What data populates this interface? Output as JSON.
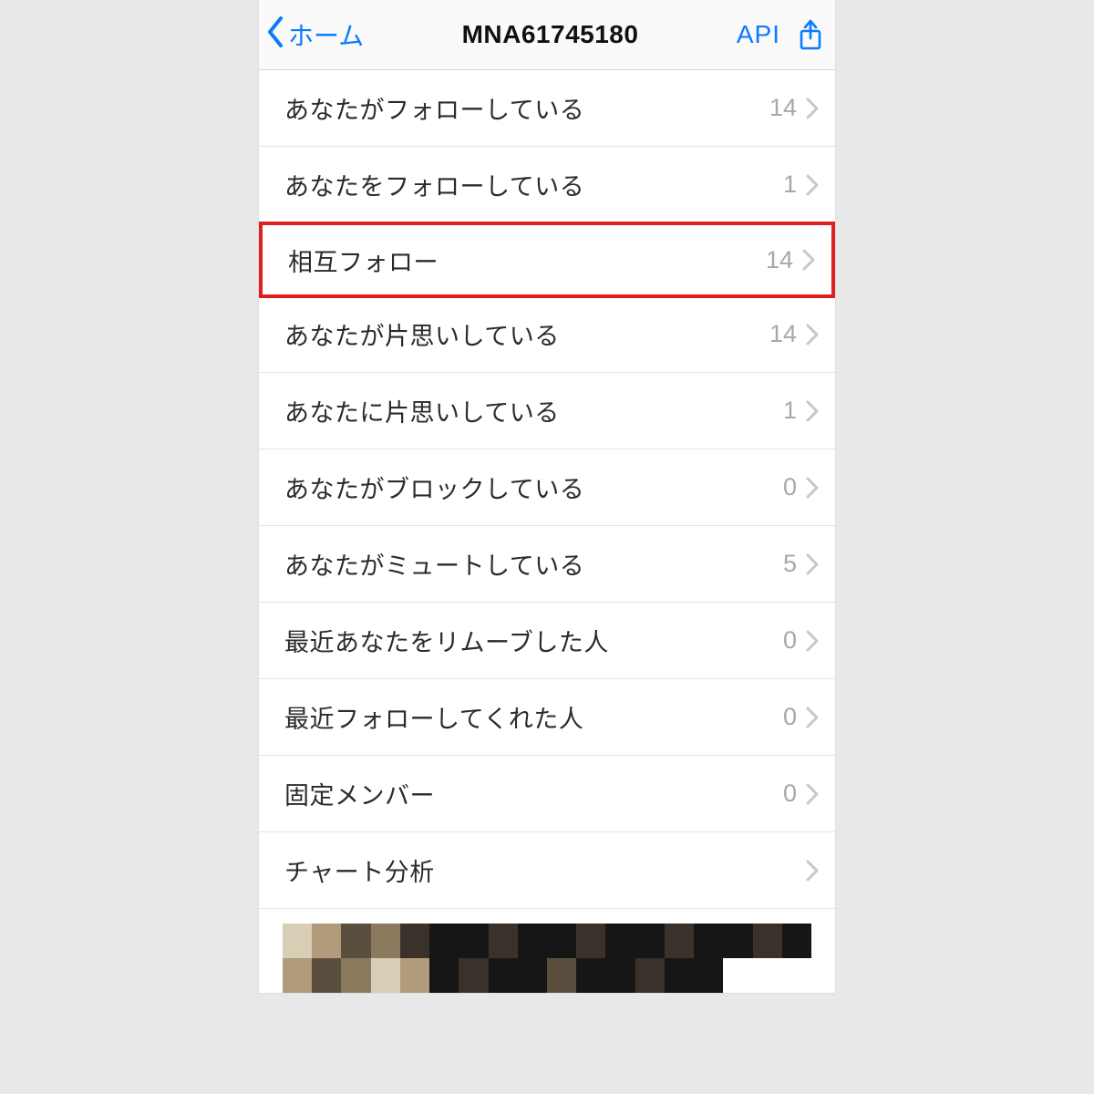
{
  "nav": {
    "back_label": "ホーム",
    "title": "MNA61745180",
    "api_label": "API"
  },
  "rows": [
    {
      "label": "あなたがフォローしている",
      "count": "14",
      "highlight": false
    },
    {
      "label": "あなたをフォローしている",
      "count": "1",
      "highlight": false
    },
    {
      "label": "相互フォロー",
      "count": "14",
      "highlight": true
    },
    {
      "label": "あなたが片思いしている",
      "count": "14",
      "highlight": false
    },
    {
      "label": "あなたに片思いしている",
      "count": "1",
      "highlight": false
    },
    {
      "label": "あなたがブロックしている",
      "count": "0",
      "highlight": false
    },
    {
      "label": "あなたがミュートしている",
      "count": "5",
      "highlight": false
    },
    {
      "label": "最近あなたをリムーブした人",
      "count": "0",
      "highlight": false
    },
    {
      "label": "最近フォローしてくれた人",
      "count": "0",
      "highlight": false
    },
    {
      "label": "固定メンバー",
      "count": "0",
      "highlight": false
    },
    {
      "label": "チャート分析",
      "count": "",
      "highlight": false
    }
  ]
}
